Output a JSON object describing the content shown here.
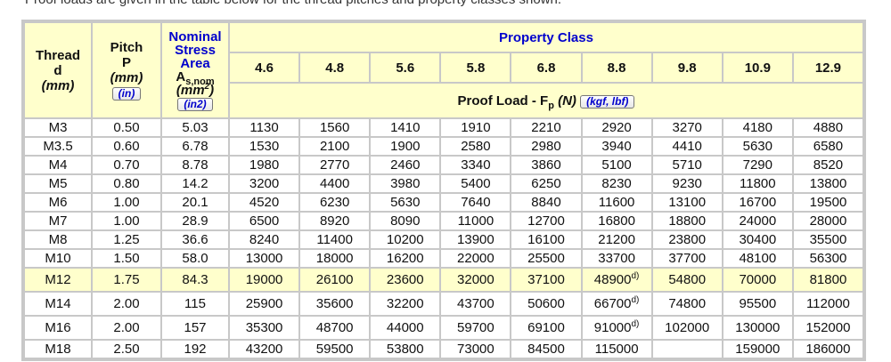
{
  "intro_text": "Proof loads are given in the table below for the thread pitches and property classes shown.",
  "headers": {
    "thread": {
      "line1": "Thread",
      "line2": "d",
      "unit": "(mm)"
    },
    "pitch": {
      "line1": "Pitch",
      "line2": "P",
      "unit": "(mm)",
      "button": "(in)"
    },
    "area": {
      "line1": "Nominal",
      "line2": "Stress",
      "line3": "Area",
      "symbol": "A",
      "symbol_sub": "s,nom",
      "unit": "(mm",
      "unit_sup": "2",
      "unit_close": ")",
      "button": "(in2)"
    },
    "property_class": "Property Class",
    "classes": [
      "4.6",
      "4.8",
      "5.6",
      "5.8",
      "6.8",
      "8.8",
      "9.8",
      "10.9",
      "12.9"
    ],
    "proof_load": {
      "label": "Proof Load - F",
      "sub": "p",
      "unit": "(N)",
      "button": "(kgf, lbf)"
    }
  },
  "rows": [
    {
      "thread": "M3",
      "pitch": "0.50",
      "area": "5.03",
      "values": [
        "1130",
        "1560",
        "1410",
        "1910",
        "2210",
        "2920",
        "3270",
        "4180",
        "4880"
      ]
    },
    {
      "thread": "M3.5",
      "pitch": "0.60",
      "area": "6.78",
      "values": [
        "1530",
        "2100",
        "1900",
        "2580",
        "2980",
        "3940",
        "4410",
        "5630",
        "6580"
      ]
    },
    {
      "thread": "M4",
      "pitch": "0.70",
      "area": "8.78",
      "values": [
        "1980",
        "2770",
        "2460",
        "3340",
        "3860",
        "5100",
        "5710",
        "7290",
        "8520"
      ]
    },
    {
      "thread": "M5",
      "pitch": "0.80",
      "area": "14.2",
      "values": [
        "3200",
        "4400",
        "3980",
        "5400",
        "6250",
        "8230",
        "9230",
        "11800",
        "13800"
      ]
    },
    {
      "thread": "M6",
      "pitch": "1.00",
      "area": "20.1",
      "values": [
        "4520",
        "6230",
        "5630",
        "7640",
        "8840",
        "11600",
        "13100",
        "16700",
        "19500"
      ]
    },
    {
      "thread": "M7",
      "pitch": "1.00",
      "area": "28.9",
      "values": [
        "6500",
        "8920",
        "8090",
        "11000",
        "12700",
        "16800",
        "18800",
        "24000",
        "28000"
      ]
    },
    {
      "thread": "M8",
      "pitch": "1.25",
      "area": "36.6",
      "values": [
        "8240",
        "11400",
        "10200",
        "13900",
        "16100",
        "21200",
        "23800",
        "30400",
        "35500"
      ]
    },
    {
      "thread": "M10",
      "pitch": "1.50",
      "area": "58.0",
      "values": [
        "13000",
        "18000",
        "16200",
        "22000",
        "25500",
        "33700",
        "37700",
        "48100",
        "56300"
      ]
    },
    {
      "thread": "M12",
      "pitch": "1.75",
      "area": "84.3",
      "highlight": true,
      "note_col": 5,
      "note": "d)",
      "values": [
        "19000",
        "26100",
        "23600",
        "32000",
        "37100",
        "48900",
        "54800",
        "70000",
        "81800"
      ]
    },
    {
      "thread": "M14",
      "pitch": "2.00",
      "area": "115",
      "note_col": 5,
      "note": "d)",
      "values": [
        "25900",
        "35600",
        "32200",
        "43700",
        "50600",
        "66700",
        "74800",
        "95500",
        "112000"
      ]
    },
    {
      "thread": "M16",
      "pitch": "2.00",
      "area": "157",
      "note_col": 5,
      "note": "d)",
      "values": [
        "35300",
        "48700",
        "44000",
        "59700",
        "69100",
        "91000",
        "102000",
        "130000",
        "152000"
      ]
    },
    {
      "thread": "M18",
      "pitch": "2.50",
      "area": "192",
      "values": [
        "43200",
        "59500",
        "53800",
        "73000",
        "84500",
        "115000",
        "",
        "159000",
        "186000"
      ]
    }
  ]
}
